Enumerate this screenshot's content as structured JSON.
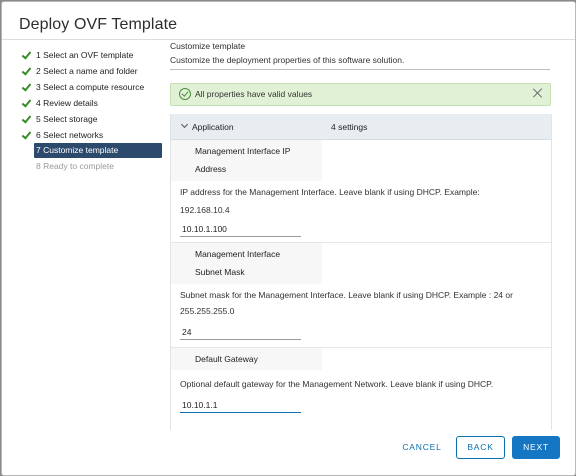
{
  "dialog": {
    "title": "Deploy OVF Template"
  },
  "steps": [
    {
      "label": "1 Select an OVF template",
      "state": "done"
    },
    {
      "label": "2 Select a name and folder",
      "state": "done"
    },
    {
      "label": "3 Select a compute resource",
      "state": "done"
    },
    {
      "label": "4 Review details",
      "state": "done"
    },
    {
      "label": "5 Select storage",
      "state": "done"
    },
    {
      "label": "6 Select networks",
      "state": "done"
    },
    {
      "label": "7 Customize template",
      "state": "active"
    },
    {
      "label": "8 Ready to complete",
      "state": "disabled"
    }
  ],
  "panel": {
    "title": "Customize template",
    "subtitle": "Customize the deployment properties of this software solution."
  },
  "alert": {
    "text": "All properties have valid values"
  },
  "group": {
    "name": "Application",
    "count": "4 settings"
  },
  "fields": [
    {
      "name_line1": "Management Interface IP",
      "name_line2": "Address",
      "desc_line1": "IP address for the Management Interface. Leave blank if using DHCP. Example:",
      "desc_line2": "192.168.10.4",
      "value": "10.10.1.100"
    },
    {
      "name_line1": "Management Interface",
      "name_line2": "Subnet Mask",
      "desc_line1": "Subnet mask for the Management Interface. Leave blank if using DHCP. Example : 24 or",
      "desc_line2": "255.255.255.0",
      "value": "24"
    },
    {
      "name_line1": "Default Gateway",
      "desc_line1": "Optional default gateway for the Management Network. Leave blank if using DHCP.",
      "value": "10.10.1.1"
    }
  ],
  "footer": {
    "cancel": "CANCEL",
    "back": "BACK",
    "next": "NEXT"
  },
  "colors": {
    "accent": "#1576c4",
    "active_step": "#2c4a6b",
    "success": "#4b8c3a"
  }
}
